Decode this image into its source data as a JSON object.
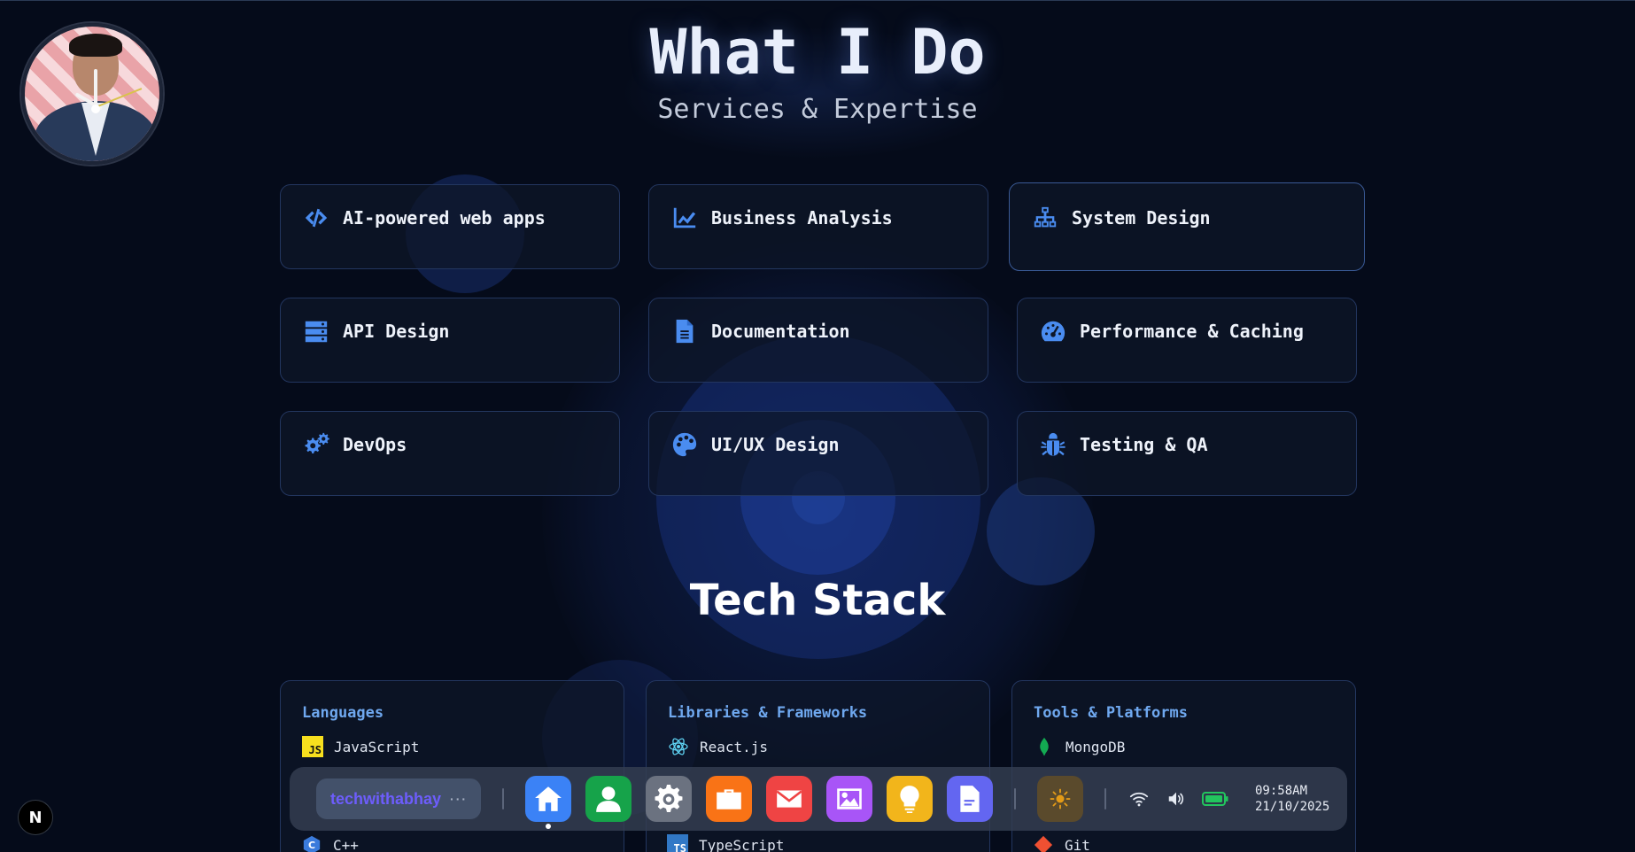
{
  "header": {
    "title": "What I Do",
    "subtitle": "Services & Expertise"
  },
  "services": [
    {
      "label": "AI-powered web apps",
      "icon": "code-icon"
    },
    {
      "label": "Business Analysis",
      "icon": "chart-line-icon"
    },
    {
      "label": "System Design",
      "icon": "sitemap-icon"
    },
    {
      "label": "API Design",
      "icon": "server-icon"
    },
    {
      "label": "Documentation",
      "icon": "file-text-icon"
    },
    {
      "label": "Performance & Caching",
      "icon": "gauge-icon"
    },
    {
      "label": "DevOps",
      "icon": "gears-icon"
    },
    {
      "label": "UI/UX Design",
      "icon": "palette-icon"
    },
    {
      "label": "Testing & QA",
      "icon": "bug-icon"
    }
  ],
  "tech_stack": {
    "title": "Tech Stack",
    "groups": [
      {
        "title": "Languages",
        "items": [
          "JavaScript",
          "C++"
        ]
      },
      {
        "title": "Libraries & Frameworks",
        "items": [
          "React.js",
          "TypeScript"
        ]
      },
      {
        "title": "Tools & Platforms",
        "items": [
          "MongoDB",
          "Git"
        ]
      }
    ]
  },
  "dock": {
    "brand": "techwithabhay",
    "brand_more": "···",
    "apps": [
      {
        "name": "home",
        "icon": "home-icon",
        "color": "#3b82f6",
        "active": true
      },
      {
        "name": "about",
        "icon": "user-icon",
        "color": "#16a34a"
      },
      {
        "name": "settings",
        "icon": "gear-icon",
        "color": "#6b7280"
      },
      {
        "name": "work",
        "icon": "briefcase-icon",
        "color": "#f97316"
      },
      {
        "name": "mail",
        "icon": "mail-icon",
        "color": "#ef4444"
      },
      {
        "name": "gallery",
        "icon": "image-icon",
        "color": "#a855f7"
      },
      {
        "name": "ideas",
        "icon": "lightbulb-icon",
        "color": "#f2b51b"
      },
      {
        "name": "docs",
        "icon": "document-icon",
        "color": "#6366f1"
      }
    ],
    "theme_icon": "sun-icon",
    "system": {
      "wifi_icon": "wifi-icon",
      "volume_icon": "volume-icon",
      "battery_icon": "battery-icon",
      "time": "09:58AM",
      "date": "21/10/2025"
    }
  },
  "corner_badge": "N",
  "colors": {
    "background": "#050b1a",
    "accent": "#4a8cf0",
    "card_border": "#23365f",
    "section_heading": "#6fa8ef"
  }
}
